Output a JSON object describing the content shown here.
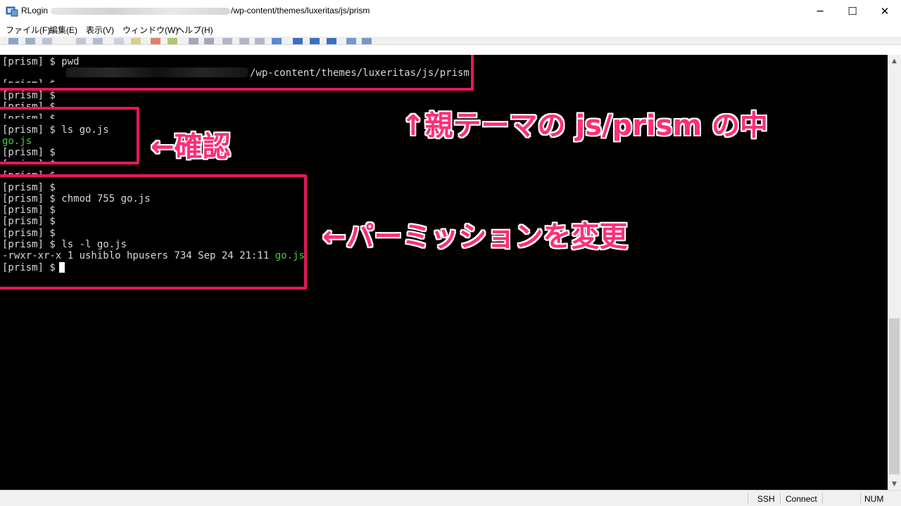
{
  "window": {
    "app_title": "RLogin -",
    "title_path": "/wp-content/themes/luxeritas/js/prism",
    "minimize_glyph": "─",
    "maximize_glyph": "☐",
    "close_glyph": "✕"
  },
  "menu": {
    "items": [
      "ファイル(F)",
      "編集(E)",
      "表示(V)",
      "ウィンドウ(W)",
      "ヘルプ(H)"
    ]
  },
  "terminal": {
    "lines": [
      "[prism] $ pwd",
      "/wp-content/themes/luxeritas/js/prism",
      "[prism] $",
      "[prism] $",
      "[prism] $",
      "[prism] $",
      "[prism] $ ls go.js",
      "go.js",
      "[prism] $",
      "[prism] $",
      "[prism] $",
      "[prism] $",
      "[prism] $ chmod 755 go.js",
      "[prism] $",
      "[prism] $",
      "[prism] $",
      "[prism] $ ls -l go.js",
      "-rwxr-xr-x 1 ushiblo hpusers 734 Sep 24 21:11 ",
      "go.js",
      "[prism] $ "
    ]
  },
  "annotations": {
    "parent_theme": "↑親テーマの js/prism の中",
    "confirm": "←確認",
    "permission": "←パーミッションを変更"
  },
  "statusbar": {
    "ssh": "SSH",
    "connect": "Connect",
    "num": "NUM"
  },
  "colors": {
    "accent": "#e8165c",
    "terminal_bg": "#000000",
    "terminal_fg": "#d8d8d8",
    "file_green": "#3fd13f"
  }
}
